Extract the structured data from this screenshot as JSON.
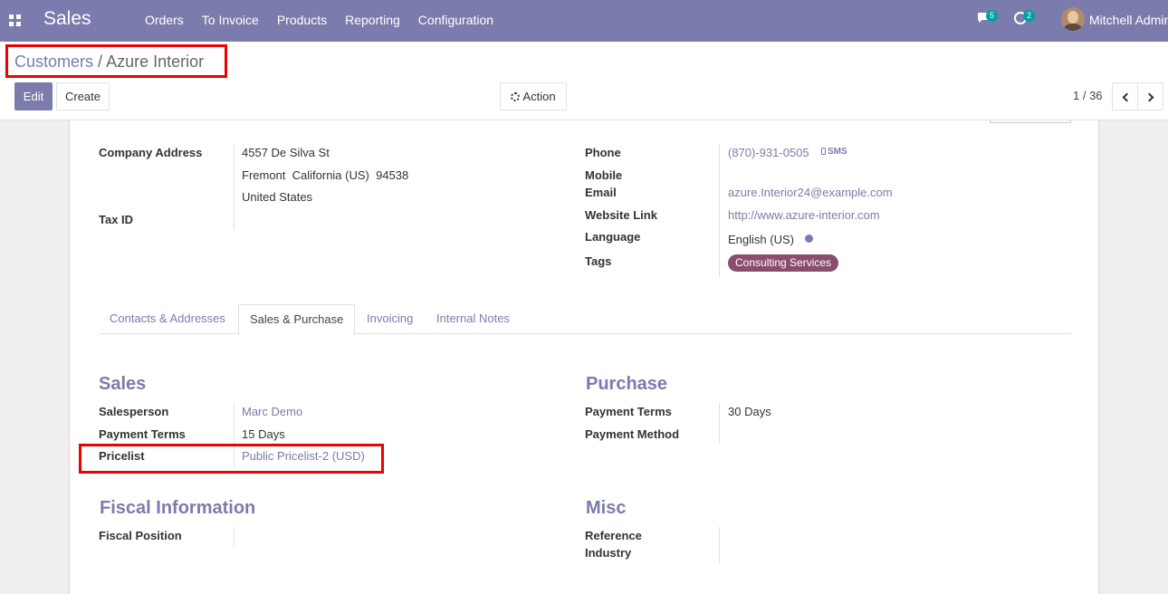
{
  "navbar": {
    "app_name": "Sales",
    "menu": [
      "Orders",
      "To Invoice",
      "Products",
      "Reporting",
      "Configuration"
    ],
    "messages_count": "5",
    "activities_count": "2",
    "user_name": "Mitchell Admin"
  },
  "control": {
    "breadcrumb_parent": "Customers",
    "breadcrumb_sep": "/",
    "breadcrumb_current": "Azure Interior",
    "edit_label": "Edit",
    "create_label": "Create",
    "action_label": "Action",
    "pager": "1 / 36"
  },
  "partner": {
    "company_address_label": "Company Address",
    "street": "4557 De Silva St",
    "city_line": "Fremont  California (US)  94538",
    "country": "United States",
    "tax_id_label": "Tax ID",
    "phone_label": "Phone",
    "phone": "(870)-931-0505",
    "sms_label": "SMS",
    "mobile_label": "Mobile",
    "email_label": "Email",
    "email": "azure.Interior24@example.com",
    "website_label": "Website Link",
    "website": "http://www.azure-interior.com",
    "language_label": "Language",
    "language": "English (US)",
    "tags_label": "Tags",
    "tag": "Consulting Services"
  },
  "tabs": [
    "Contacts & Addresses",
    "Sales & Purchase",
    "Invoicing",
    "Internal Notes"
  ],
  "sales": {
    "title": "Sales",
    "salesperson_label": "Salesperson",
    "salesperson": "Marc Demo",
    "payment_terms_label": "Payment Terms",
    "payment_terms": "15 Days",
    "pricelist_label": "Pricelist",
    "pricelist": "Public Pricelist-2 (USD)"
  },
  "purchase": {
    "title": "Purchase",
    "payment_terms_label": "Payment Terms",
    "payment_terms": "30 Days",
    "payment_method_label": "Payment Method"
  },
  "fiscal": {
    "title": "Fiscal Information",
    "fiscal_position_label": "Fiscal Position"
  },
  "misc": {
    "title": "Misc",
    "reference_label": "Reference",
    "industry_label": "Industry"
  },
  "colors": {
    "navbar": "#7c7bad",
    "tag": "#8a4d6d",
    "highlight": "#e00000"
  }
}
